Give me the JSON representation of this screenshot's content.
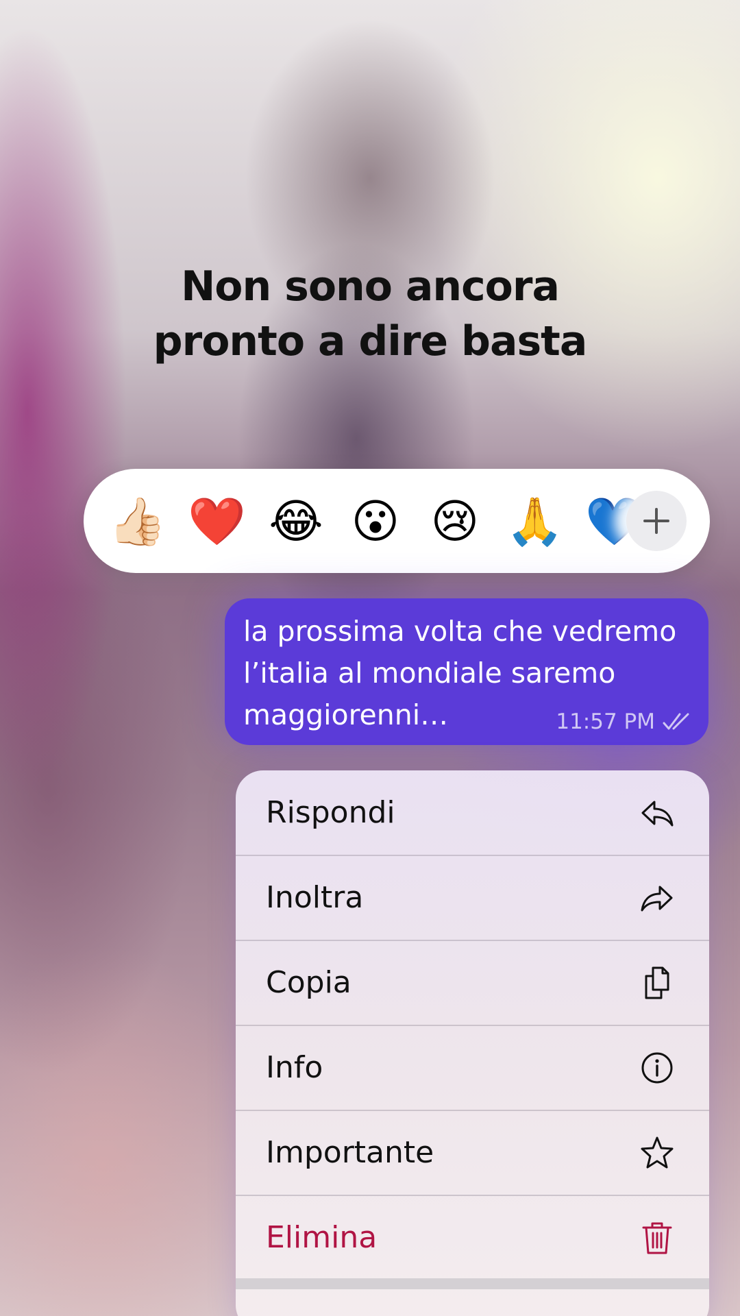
{
  "caption": {
    "line1": "Non sono ancora",
    "line2": "pronto a dire basta"
  },
  "reactions": {
    "items": [
      {
        "name": "thumbs-up",
        "glyph": "👍🏻"
      },
      {
        "name": "red-heart",
        "glyph": "❤️"
      },
      {
        "name": "tears-of-joy",
        "glyph": "😂"
      },
      {
        "name": "surprised",
        "glyph": "😮"
      },
      {
        "name": "crying",
        "glyph": "😢"
      },
      {
        "name": "folded-hands",
        "glyph": "🙏"
      },
      {
        "name": "blue-heart",
        "glyph": "💙"
      }
    ],
    "more_icon": "plus-icon"
  },
  "message": {
    "lines": [
      "la prossima volta che vedremo",
      "l’italia al mondiale saremo",
      "maggiorenni…"
    ],
    "time": "11:57 PM",
    "status_icon": "double-check-icon",
    "bubble_color": "#5b3bd8"
  },
  "menu": {
    "items": [
      {
        "label": "Rispondi",
        "icon": "reply-icon"
      },
      {
        "label": "Inoltra",
        "icon": "forward-icon"
      },
      {
        "label": "Copia",
        "icon": "copy-icon"
      },
      {
        "label": "Info",
        "icon": "info-icon"
      },
      {
        "label": "Importante",
        "icon": "star-icon"
      },
      {
        "label": "Elimina",
        "icon": "trash-icon",
        "color": "#b01444"
      }
    ]
  }
}
